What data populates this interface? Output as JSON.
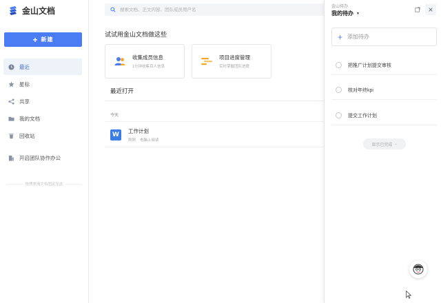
{
  "app": {
    "name": "金山文档"
  },
  "sidebar": {
    "new_button_label": "新建",
    "items": [
      {
        "label": "最近",
        "icon": "clock-icon",
        "active": true
      },
      {
        "label": "星标",
        "icon": "star-icon",
        "active": false
      },
      {
        "label": "共享",
        "icon": "share-icon",
        "active": false
      },
      {
        "label": "我的文档",
        "icon": "folder-icon",
        "active": false
      },
      {
        "label": "回收站",
        "icon": "trash-icon",
        "active": false
      }
    ],
    "team_label": "开启团队协作办公",
    "divider_text": "拖拽常用文档固定至此"
  },
  "search": {
    "placeholder": "搜索文档、正文内容、团队成员用户名"
  },
  "main": {
    "try_title": "试试用金山文档做这些",
    "cards": [
      {
        "title": "收集成员信息",
        "subtitle": "1分钟收集百人信息",
        "icon": "people-icon"
      },
      {
        "title": "项目进度管理",
        "subtitle": "实时掌握团队进度",
        "icon": "progress-icon"
      }
    ],
    "recent_title": "最近打开",
    "group_label": "今天",
    "files": [
      {
        "name": "工作计划",
        "time": "刚刚",
        "source": "电脑上阅读",
        "icon": "word-doc-icon",
        "icon_letter": "W"
      }
    ]
  },
  "todo_panel": {
    "app_label": "金山待办",
    "title": "我的待办",
    "add_label": "添加待办",
    "items": [
      {
        "text": "把推广计划提交审核"
      },
      {
        "text": "核对年终kpi"
      },
      {
        "text": "提交工作计划"
      }
    ],
    "show_done_label": "显示已完成"
  },
  "colors": {
    "accent": "#4a7df4",
    "doc_blue": "#3c7ce6"
  }
}
